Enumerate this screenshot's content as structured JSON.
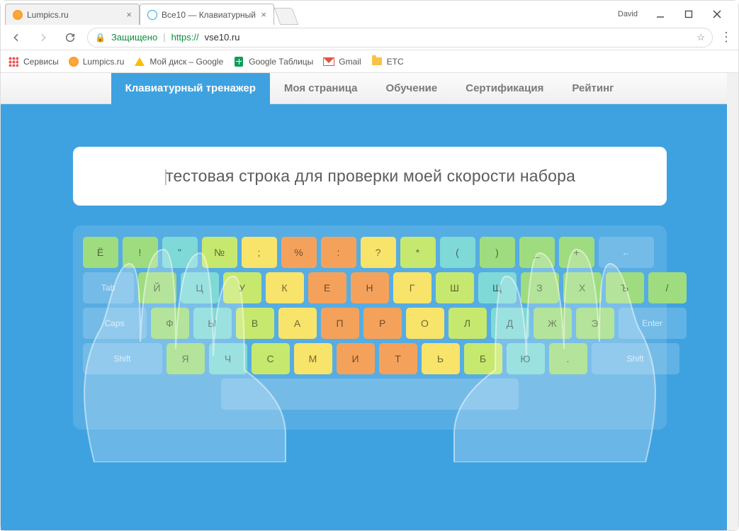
{
  "window": {
    "user_label": "David",
    "tabs": [
      {
        "title": "Lumpics.ru",
        "favicon": "orange",
        "active": false
      },
      {
        "title": "Все10 — Клавиатурный",
        "favicon": "10",
        "active": true
      }
    ]
  },
  "address_bar": {
    "secure_label": "Защищено",
    "url_scheme": "https://",
    "url_host": "vse10.ru"
  },
  "bookmarks": [
    {
      "icon": "apps",
      "label": "Сервисы"
    },
    {
      "icon": "orange",
      "label": "Lumpics.ru"
    },
    {
      "icon": "drive",
      "label": "Мой диск – Google"
    },
    {
      "icon": "sheets",
      "label": "Google Таблицы"
    },
    {
      "icon": "gmail",
      "label": "Gmail"
    },
    {
      "icon": "folder",
      "label": "ETC"
    }
  ],
  "site_nav": {
    "items": [
      {
        "label": "Клавиатурный тренажер",
        "active": true
      },
      {
        "label": "Моя страница"
      },
      {
        "label": "Обучение"
      },
      {
        "label": "Сертификация"
      },
      {
        "label": "Рейтинг"
      }
    ]
  },
  "typing_input": {
    "text": "тестовая строка для проверки моей скорости набора"
  },
  "keyboard": {
    "row1": [
      {
        "l": "Ё",
        "c": "c-green",
        "w": "w50"
      },
      {
        "l": "!",
        "c": "c-green",
        "w": "w50"
      },
      {
        "l": "\"",
        "c": "c-cyan",
        "w": "w50"
      },
      {
        "l": "№",
        "c": "c-lime",
        "w": "w50"
      },
      {
        "l": ";",
        "c": "c-yellow",
        "w": "w50"
      },
      {
        "l": "%",
        "c": "c-orange",
        "w": "w50"
      },
      {
        "l": ":",
        "c": "c-orange",
        "w": "w50"
      },
      {
        "l": "?",
        "c": "c-yellow",
        "w": "w50"
      },
      {
        "l": "*",
        "c": "c-lime",
        "w": "w50"
      },
      {
        "l": "(",
        "c": "c-cyan",
        "w": "w50"
      },
      {
        "l": ")",
        "c": "c-green",
        "w": "w50"
      },
      {
        "l": "_",
        "c": "c-green",
        "w": "w50"
      },
      {
        "l": "+",
        "c": "c-green",
        "w": "w50"
      },
      {
        "l": "←",
        "c": "sys",
        "w": "w78",
        "sys": true
      }
    ],
    "row2_lead": {
      "l": "Tab",
      "w": "w72"
    },
    "row2": [
      {
        "l": "Й",
        "c": "c-green"
      },
      {
        "l": "Ц",
        "c": "c-cyan"
      },
      {
        "l": "У",
        "c": "c-lime"
      },
      {
        "l": "К",
        "c": "c-yellow"
      },
      {
        "l": "Е",
        "c": "c-orange"
      },
      {
        "l": "Н",
        "c": "c-orange"
      },
      {
        "l": "Г",
        "c": "c-yellow"
      },
      {
        "l": "Ш",
        "c": "c-lime"
      },
      {
        "l": "Щ",
        "c": "c-cyan"
      },
      {
        "l": "З",
        "c": "c-green"
      },
      {
        "l": "Х",
        "c": "c-green"
      },
      {
        "l": "Ъ",
        "c": "c-green"
      },
      {
        "l": "/",
        "c": "c-green"
      }
    ],
    "row3_lead": {
      "l": "Caps",
      "w": "w90"
    },
    "row3": [
      {
        "l": "Ф",
        "c": "c-green"
      },
      {
        "l": "Ы",
        "c": "c-cyan"
      },
      {
        "l": "В",
        "c": "c-lime"
      },
      {
        "l": "А",
        "c": "c-yellow"
      },
      {
        "l": "П",
        "c": "c-orange"
      },
      {
        "l": "Р",
        "c": "c-orange"
      },
      {
        "l": "О",
        "c": "c-yellow"
      },
      {
        "l": "Л",
        "c": "c-lime"
      },
      {
        "l": "Д",
        "c": "c-cyan"
      },
      {
        "l": "Ж",
        "c": "c-green"
      },
      {
        "l": "Э",
        "c": "c-green"
      }
    ],
    "row3_trail": {
      "l": "Enter",
      "w": "w96"
    },
    "row4_lead": {
      "l": "Shift",
      "w": "w112"
    },
    "row4": [
      {
        "l": "Я",
        "c": "c-green"
      },
      {
        "l": "Ч",
        "c": "c-cyan"
      },
      {
        "l": "С",
        "c": "c-lime"
      },
      {
        "l": "М",
        "c": "c-yellow"
      },
      {
        "l": "И",
        "c": "c-orange"
      },
      {
        "l": "Т",
        "c": "c-orange"
      },
      {
        "l": "Ь",
        "c": "c-yellow"
      },
      {
        "l": "Б",
        "c": "c-lime"
      },
      {
        "l": "Ю",
        "c": "c-cyan"
      },
      {
        "l": ".",
        "c": "c-green"
      }
    ],
    "row4_trail": {
      "l": "Shift",
      "w": "w124"
    }
  }
}
